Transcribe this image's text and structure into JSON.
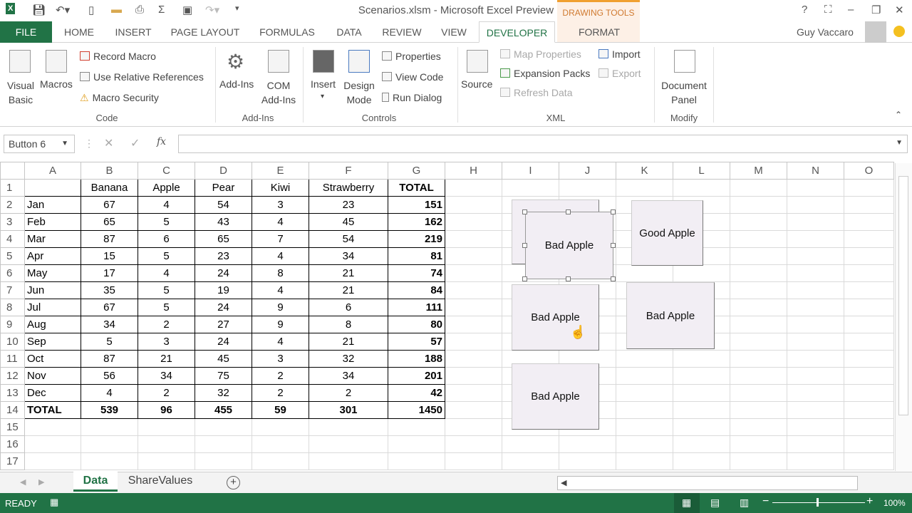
{
  "window": {
    "title": "Scenarios.xlsm - Microsoft Excel Preview",
    "context_tab": "DRAWING TOOLS",
    "user": "Guy Vaccaro"
  },
  "tabs": [
    "FILE",
    "HOME",
    "INSERT",
    "PAGE LAYOUT",
    "FORMULAS",
    "DATA",
    "REVIEW",
    "VIEW",
    "DEVELOPER",
    "FORMAT"
  ],
  "ribbon": {
    "code": {
      "label": "Code",
      "visual_basic": "Visual Basic",
      "macros": "Macros",
      "record": "Record Macro",
      "relative": "Use Relative References",
      "security": "Macro Security"
    },
    "addins": {
      "label": "Add-Ins",
      "addins": "Add-Ins",
      "com": "COM Add-Ins"
    },
    "controls": {
      "label": "Controls",
      "insert": "Insert",
      "design": "Design Mode",
      "properties": "Properties",
      "view_code": "View Code",
      "run_dialog": "Run Dialog"
    },
    "xml": {
      "label": "XML",
      "source": "Source",
      "map_properties": "Map Properties",
      "expansion": "Expansion Packs",
      "refresh": "Refresh Data",
      "import": "Import",
      "export": "Export"
    },
    "modify": {
      "label": "Modify",
      "document_panel": "Document Panel"
    }
  },
  "name_box": "Button 6",
  "fx": "fx",
  "columns": [
    "A",
    "B",
    "C",
    "D",
    "E",
    "F",
    "G",
    "H",
    "I",
    "J",
    "K",
    "L",
    "M",
    "N",
    "O"
  ],
  "headers": [
    "",
    "Banana",
    "Apple",
    "Pear",
    "Kiwi",
    "Strawberry",
    "TOTAL"
  ],
  "rows": [
    [
      "Jan",
      "67",
      "4",
      "54",
      "3",
      "23",
      "151"
    ],
    [
      "Feb",
      "65",
      "5",
      "43",
      "4",
      "45",
      "162"
    ],
    [
      "Mar",
      "87",
      "6",
      "65",
      "7",
      "54",
      "219"
    ],
    [
      "Apr",
      "15",
      "5",
      "23",
      "4",
      "34",
      "81"
    ],
    [
      "May",
      "17",
      "4",
      "24",
      "8",
      "21",
      "74"
    ],
    [
      "Jun",
      "35",
      "5",
      "19",
      "4",
      "21",
      "84"
    ],
    [
      "Jul",
      "67",
      "5",
      "24",
      "9",
      "6",
      "111"
    ],
    [
      "Aug",
      "34",
      "2",
      "27",
      "9",
      "8",
      "80"
    ],
    [
      "Sep",
      "5",
      "3",
      "24",
      "4",
      "21",
      "57"
    ],
    [
      "Oct",
      "87",
      "21",
      "45",
      "3",
      "32",
      "188"
    ],
    [
      "Nov",
      "56",
      "34",
      "75",
      "2",
      "34",
      "201"
    ],
    [
      "Dec",
      "4",
      "2",
      "32",
      "2",
      "2",
      "42"
    ],
    [
      "TOTAL",
      "539",
      "96",
      "455",
      "59",
      "301",
      "1450"
    ]
  ],
  "buttons": [
    "Bad Apple",
    "Bad Apple",
    "Good Apple",
    "Bad Apple",
    "Bad Apple",
    "Bad Apple"
  ],
  "sheets": [
    "Data",
    "ShareValues"
  ],
  "status": {
    "ready": "READY",
    "zoom": "100%"
  }
}
